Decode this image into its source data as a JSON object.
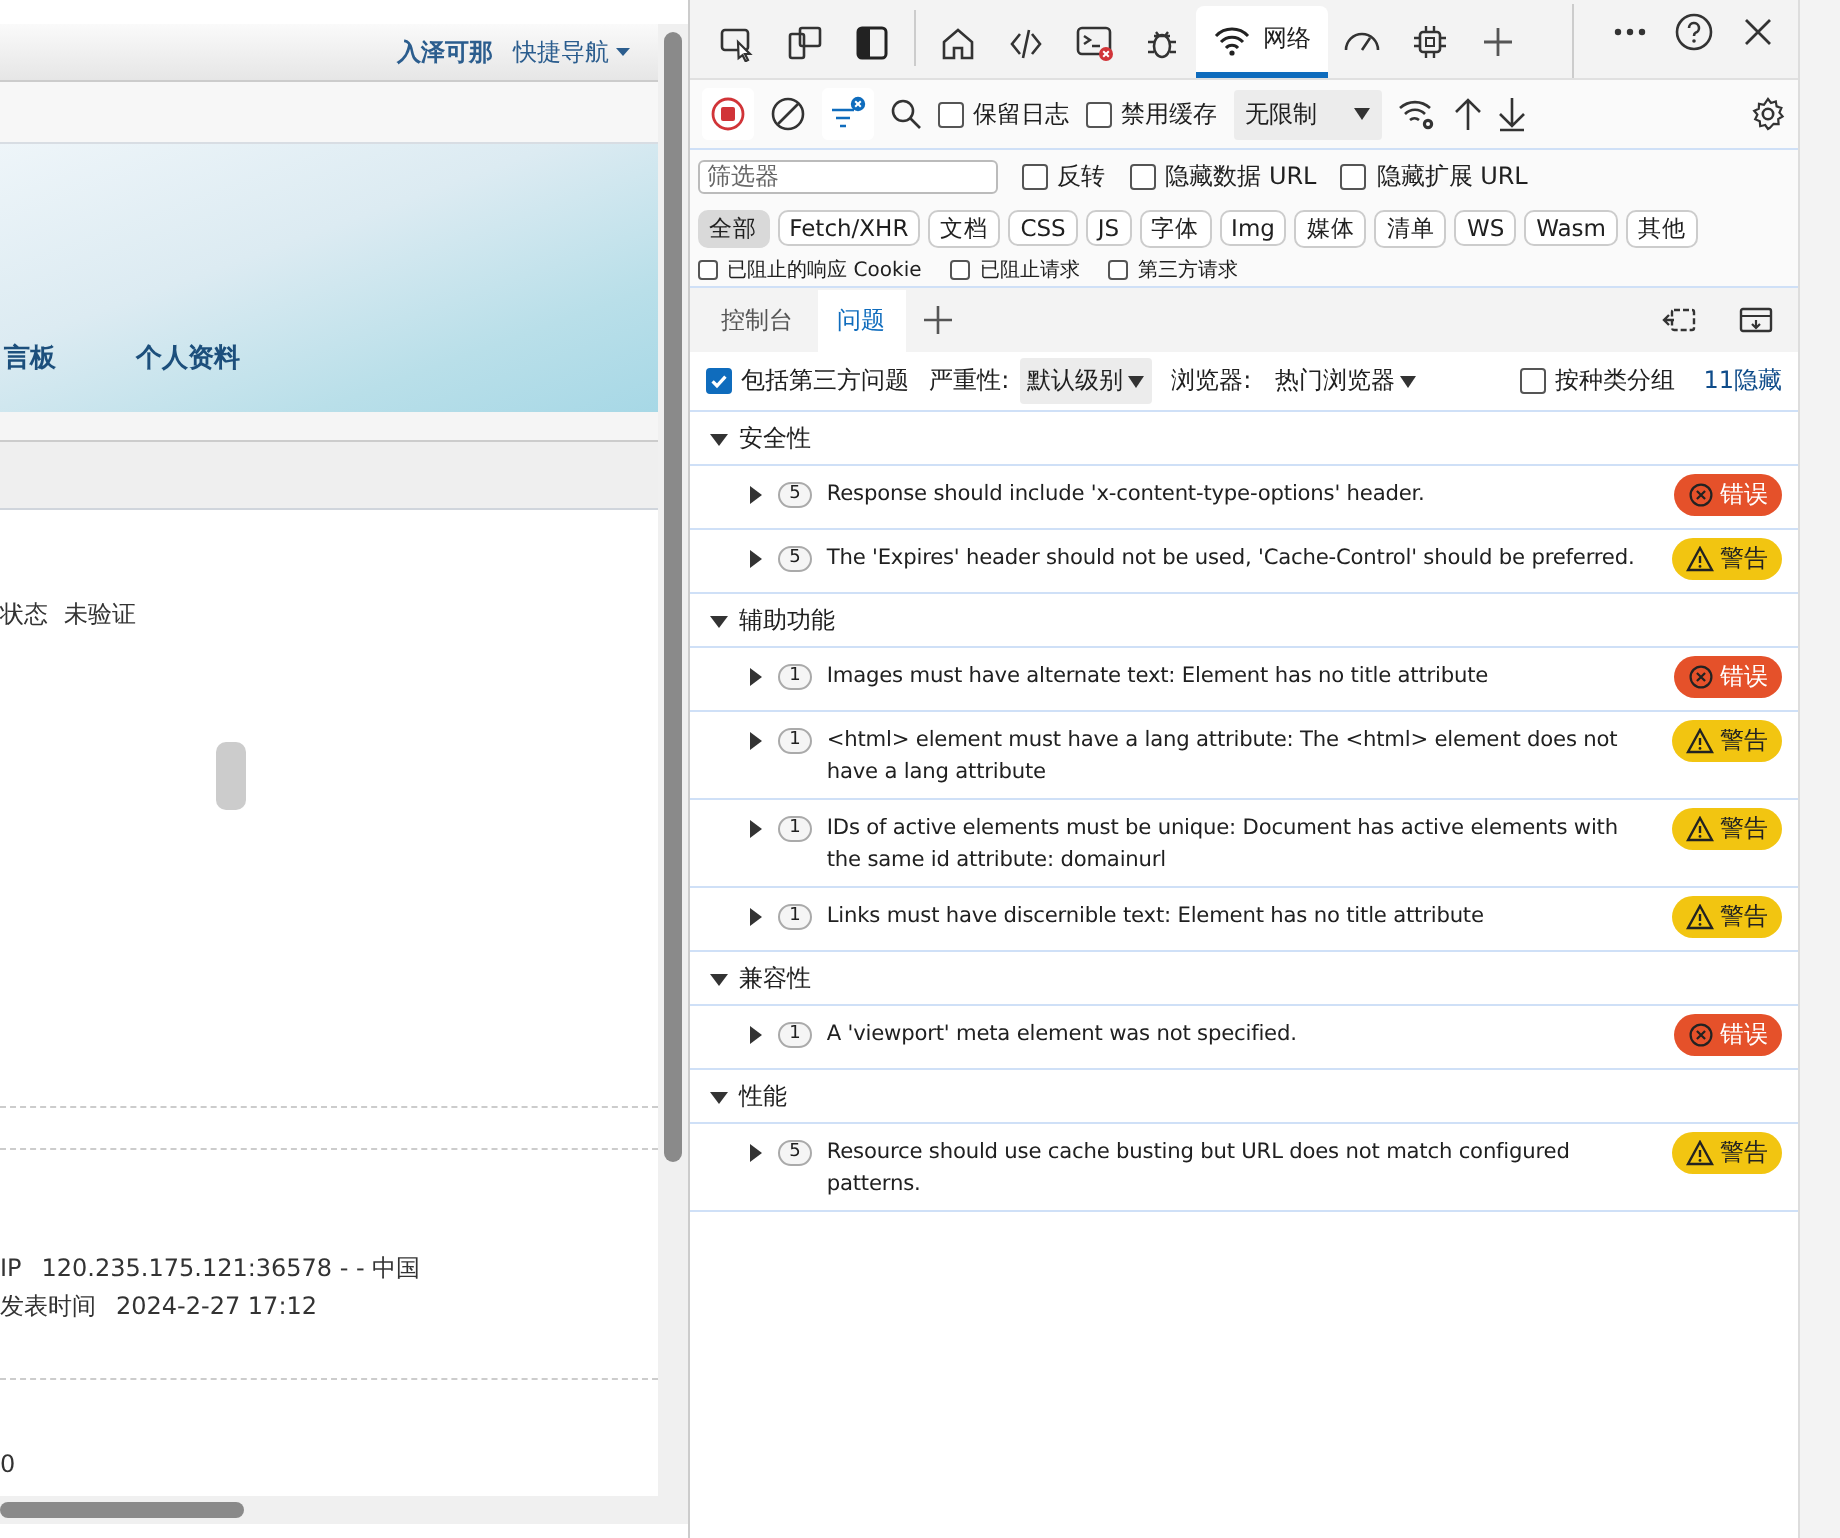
{
  "webpage": {
    "header_links": [
      {
        "text": "入泽可那",
        "kind": "user"
      },
      {
        "text": "快捷导航",
        "kind": "menu"
      }
    ],
    "nav_items": [
      "言板",
      "个人资料"
    ],
    "profile_rows": [
      {
        "label": "状态",
        "value": "未验证"
      }
    ],
    "info_rows": [
      {
        "label": "IP",
        "value": "120.235.175.121:36578 - - 中国"
      },
      {
        "label": "发表时间",
        "value": "2024-2-27 17:12"
      }
    ],
    "count": "0"
  },
  "devtools": {
    "tools": [
      {
        "kind": "inspect",
        "selected": false
      },
      {
        "kind": "device",
        "selected": false
      },
      {
        "kind": "dock",
        "selected": false
      },
      {
        "kind": "home",
        "selected": false
      },
      {
        "kind": "elements",
        "selected": false
      },
      {
        "kind": "console",
        "selected": false
      },
      {
        "kind": "sources",
        "selected": false
      },
      {
        "kind": "network",
        "label": "网络",
        "selected": true
      },
      {
        "kind": "performance",
        "selected": false
      },
      {
        "kind": "memory",
        "selected": false
      },
      {
        "kind": "add",
        "selected": false
      }
    ],
    "network_toolbar": {
      "recording": true,
      "filter_active": true,
      "preserve_log": {
        "label": "保留日志",
        "checked": false
      },
      "disable_cache": {
        "label": "禁用缓存",
        "checked": false
      },
      "throttle": "无限制"
    },
    "filter": {
      "placeholder": "筛选器",
      "options": [
        {
          "label": "反转",
          "checked": false
        },
        {
          "label": "隐藏数据 URL",
          "checked": false
        },
        {
          "label": "隐藏扩展 URL",
          "checked": false
        }
      ]
    },
    "types": [
      {
        "label": "全部",
        "selected": true
      },
      {
        "label": "Fetch/XHR",
        "selected": false
      },
      {
        "label": "文档",
        "selected": false
      },
      {
        "label": "CSS",
        "selected": false
      },
      {
        "label": "JS",
        "selected": false
      },
      {
        "label": "字体",
        "selected": false
      },
      {
        "label": "Img",
        "selected": false
      },
      {
        "label": "媒体",
        "selected": false
      },
      {
        "label": "清单",
        "selected": false
      },
      {
        "label": "WS",
        "selected": false
      },
      {
        "label": "Wasm",
        "selected": false
      },
      {
        "label": "其他",
        "selected": false
      }
    ],
    "blocked_options": [
      {
        "label": "已阻止的响应 Cookie",
        "checked": false
      },
      {
        "label": "已阻止请求",
        "checked": false
      },
      {
        "label": "第三方请求",
        "checked": false
      }
    ],
    "drawer_tabs": [
      {
        "label": "控制台",
        "selected": false
      },
      {
        "label": "问题",
        "selected": true
      }
    ],
    "issues_toolbar": {
      "third_party": {
        "label": "包括第三方问题",
        "checked": true
      },
      "severity_label": "严重性:",
      "severity": "默认级别",
      "browser_label": "浏览器:",
      "browser": "热门浏览器",
      "group_by_kind": {
        "label": "按种类分组",
        "checked": false
      },
      "hidden": "11隐藏"
    },
    "groups": [
      {
        "title": "安全性",
        "expanded": true,
        "issues": [
          {
            "count": "5",
            "text": "Response should include 'x-content-type-options' header.",
            "kind": "error",
            "badge": "错误",
            "expanded": false
          },
          {
            "count": "5",
            "text": "The 'Expires' header should not be used, 'Cache-Control' should be preferred.",
            "kind": "warning",
            "badge": "警告",
            "expanded": false
          }
        ]
      },
      {
        "title": "辅助功能",
        "expanded": true,
        "issues": [
          {
            "count": "1",
            "text": "Images must have alternate text: Element has no title attribute",
            "kind": "error",
            "badge": "错误",
            "expanded": false
          },
          {
            "count": "1",
            "text": "<html> element must have a lang attribute: The <html> element does not have a lang attribute",
            "kind": "warning",
            "badge": "警告",
            "expanded": false
          },
          {
            "count": "1",
            "text": "IDs of active elements must be unique: Document has active elements with the same id attribute: domainurl",
            "kind": "warning",
            "badge": "警告",
            "expanded": false
          },
          {
            "count": "1",
            "text": "Links must have discernible text: Element has no title attribute",
            "kind": "warning",
            "badge": "警告",
            "expanded": false
          }
        ]
      },
      {
        "title": "兼容性",
        "expanded": true,
        "issues": [
          {
            "count": "1",
            "text": "A 'viewport' meta element was not specified.",
            "kind": "error",
            "badge": "错误",
            "expanded": false
          }
        ]
      },
      {
        "title": "性能",
        "expanded": true,
        "issues": [
          {
            "count": "5",
            "text": "Resource should use cache busting but URL does not match configured patterns.",
            "kind": "warning",
            "badge": "警告",
            "expanded": false
          }
        ]
      }
    ]
  }
}
